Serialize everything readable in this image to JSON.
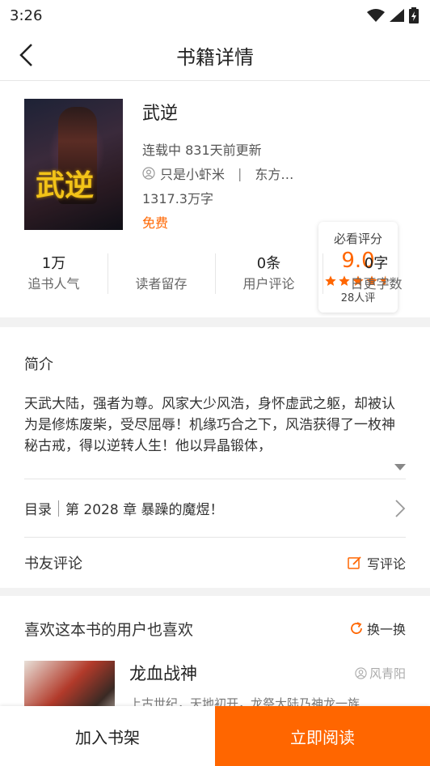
{
  "status": {
    "time": "3:26"
  },
  "nav": {
    "title": "书籍详情"
  },
  "book": {
    "title": "武逆",
    "status_update": "连载中 831天前更新",
    "author": "只是小虾米",
    "author_sep": "|",
    "category": "东方…",
    "words": "1317.3万字",
    "price": "免费",
    "cover_title": "武逆"
  },
  "rating": {
    "label": "必看评分",
    "score": "9.0",
    "stars": 4.5,
    "count": "28人评"
  },
  "stats": [
    {
      "value": "1万",
      "label": "追书人气"
    },
    {
      "value": "",
      "label": "读者留存"
    },
    {
      "value": "0条",
      "label": "用户评论"
    },
    {
      "value": "0字",
      "label": "日更字数"
    }
  ],
  "intro": {
    "title": "简介",
    "text": "天武大陆，强者为尊。风家大少风浩，身怀虚武之躯，却被认为是修炼废柴，受尽屈辱！机缘巧合之下，风浩获得了一枚神秘古戒，得以逆转人生！他以异晶锻体，"
  },
  "toc": {
    "label": "目录",
    "latest": "第 2028 章 暴躁的魔煜！"
  },
  "comments": {
    "title": "书友评论",
    "write_label": "写评论"
  },
  "likes": {
    "title": "喜欢这本书的用户也喜欢",
    "refresh_label": "换一换",
    "items": [
      {
        "title": "龙血战神",
        "author": "风青阳",
        "desc": "上古世纪，天地初开，龙祭大陆乃神龙一族"
      }
    ]
  },
  "bottom": {
    "shelf_label": "加入书架",
    "read_label": "立即阅读"
  },
  "colors": {
    "accent": "#ff6600",
    "divider": "#e6e6e6",
    "section_bg": "#f2f2f2"
  }
}
